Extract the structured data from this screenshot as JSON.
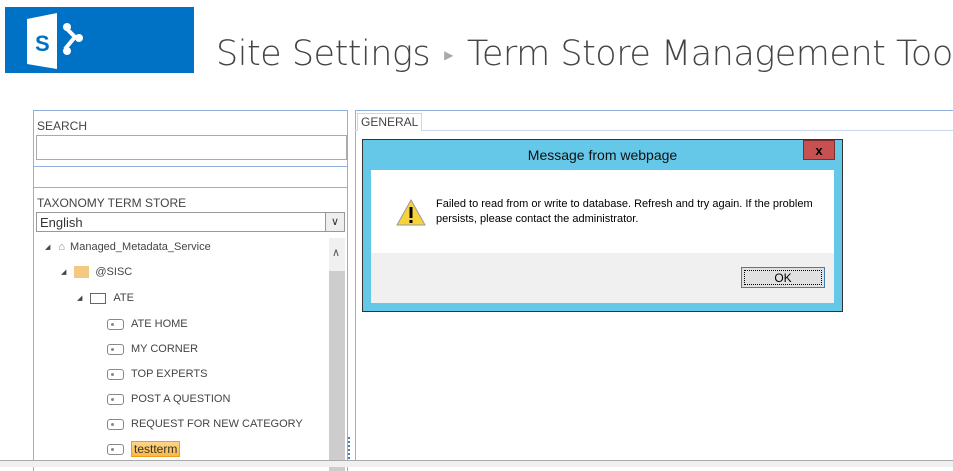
{
  "header": {
    "breadcrumb": [
      "Site Settings",
      "Term Store Management Tool"
    ],
    "logo_letter": "S"
  },
  "left": {
    "search_label": "SEARCH",
    "search_value": "",
    "taxonomy_label": "TAXONOMY TERM STORE",
    "language": "English",
    "tree": {
      "root": "Managed_Metadata_Service",
      "group": "@SISC",
      "termset": "ATE",
      "terms": [
        "ATE HOME",
        "MY CORNER",
        "TOP EXPERTS",
        "POST A QUESTION",
        "REQUEST FOR NEW CATEGORY"
      ],
      "selected_term": "testterm"
    }
  },
  "right": {
    "tab": "GENERAL"
  },
  "dialog": {
    "title": "Message from webpage",
    "close": "x",
    "message": "Failed to read from or write to database. Refresh and try again. If the problem persists, please contact the administrator.",
    "ok": "OK"
  },
  "colors": {
    "brand": "#0072c6",
    "dialog": "#65c8e8",
    "close": "#c75050",
    "highlight": "#fbb843"
  }
}
